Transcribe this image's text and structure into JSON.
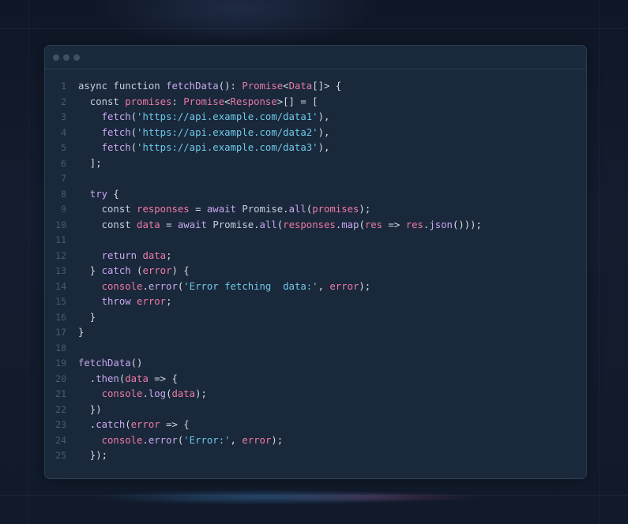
{
  "editor": {
    "lines": [
      {
        "n": "1",
        "tokens": [
          [
            "k",
            "async function "
          ],
          [
            "f",
            "fetchData"
          ],
          [
            "p",
            "(): "
          ],
          [
            "t",
            "Promise"
          ],
          [
            "p",
            "<"
          ],
          [
            "t",
            "Data"
          ],
          [
            "p",
            "[]> {"
          ]
        ]
      },
      {
        "n": "2",
        "tokens": [
          [
            "k",
            "  const "
          ],
          [
            "v",
            "promises"
          ],
          [
            "p",
            ": "
          ],
          [
            "t",
            "Promise"
          ],
          [
            "p",
            "<"
          ],
          [
            "t",
            "Response"
          ],
          [
            "p",
            ">[] = ["
          ]
        ]
      },
      {
        "n": "3",
        "tokens": [
          [
            "f",
            "    fetch"
          ],
          [
            "p",
            "("
          ],
          [
            "s",
            "'https://api.example.com/data1'"
          ],
          [
            "p",
            "),"
          ]
        ]
      },
      {
        "n": "4",
        "tokens": [
          [
            "f",
            "    fetch"
          ],
          [
            "p",
            "("
          ],
          [
            "s",
            "'https://api.example.com/data2'"
          ],
          [
            "p",
            "),"
          ]
        ]
      },
      {
        "n": "5",
        "tokens": [
          [
            "f",
            "    fetch"
          ],
          [
            "p",
            "("
          ],
          [
            "s",
            "'https://api.example.com/data3'"
          ],
          [
            "p",
            "),"
          ]
        ]
      },
      {
        "n": "6",
        "tokens": [
          [
            "p",
            "  ];"
          ]
        ]
      },
      {
        "n": "7",
        "tokens": []
      },
      {
        "n": "8",
        "tokens": [
          [
            "f",
            "  try"
          ],
          [
            "p",
            " {"
          ]
        ]
      },
      {
        "n": "9",
        "tokens": [
          [
            "k",
            "    const "
          ],
          [
            "v",
            "responses"
          ],
          [
            "p",
            " = "
          ],
          [
            "f",
            "await "
          ],
          [
            "k",
            "Promise"
          ],
          [
            "p",
            "."
          ],
          [
            "f",
            "all"
          ],
          [
            "p",
            "("
          ],
          [
            "v",
            "promises"
          ],
          [
            "p",
            ");"
          ]
        ]
      },
      {
        "n": "10",
        "tokens": [
          [
            "k",
            "    const "
          ],
          [
            "v",
            "data"
          ],
          [
            "p",
            " = "
          ],
          [
            "f",
            "await "
          ],
          [
            "k",
            "Promise"
          ],
          [
            "p",
            "."
          ],
          [
            "f",
            "all"
          ],
          [
            "p",
            "("
          ],
          [
            "v",
            "responses"
          ],
          [
            "p",
            "."
          ],
          [
            "f",
            "map"
          ],
          [
            "p",
            "("
          ],
          [
            "v",
            "res"
          ],
          [
            "p",
            " => "
          ],
          [
            "v",
            "res"
          ],
          [
            "p",
            "."
          ],
          [
            "f",
            "json"
          ],
          [
            "p",
            "()));"
          ]
        ]
      },
      {
        "n": "11",
        "tokens": []
      },
      {
        "n": "12",
        "tokens": [
          [
            "f",
            "    return "
          ],
          [
            "v",
            "data"
          ],
          [
            "p",
            ";"
          ]
        ]
      },
      {
        "n": "13",
        "tokens": [
          [
            "p",
            "  } "
          ],
          [
            "f",
            "catch"
          ],
          [
            "p",
            " ("
          ],
          [
            "v",
            "error"
          ],
          [
            "p",
            ") {"
          ]
        ]
      },
      {
        "n": "14",
        "tokens": [
          [
            "v",
            "    console"
          ],
          [
            "p",
            "."
          ],
          [
            "f",
            "error"
          ],
          [
            "p",
            "("
          ],
          [
            "s",
            "'Error fetching  data:'"
          ],
          [
            "p",
            ", "
          ],
          [
            "v",
            "error"
          ],
          [
            "p",
            ");"
          ]
        ]
      },
      {
        "n": "15",
        "tokens": [
          [
            "f",
            "    throw "
          ],
          [
            "v",
            "error"
          ],
          [
            "p",
            ";"
          ]
        ]
      },
      {
        "n": "16",
        "tokens": [
          [
            "p",
            "  }"
          ]
        ]
      },
      {
        "n": "17",
        "tokens": [
          [
            "p",
            "}"
          ]
        ]
      },
      {
        "n": "18",
        "tokens": []
      },
      {
        "n": "19",
        "tokens": [
          [
            "f",
            "fetchData"
          ],
          [
            "p",
            "()"
          ]
        ]
      },
      {
        "n": "20",
        "tokens": [
          [
            "p",
            "  ."
          ],
          [
            "f",
            "then"
          ],
          [
            "p",
            "("
          ],
          [
            "v",
            "data"
          ],
          [
            "p",
            " => {"
          ]
        ]
      },
      {
        "n": "21",
        "tokens": [
          [
            "v",
            "    console"
          ],
          [
            "p",
            "."
          ],
          [
            "f",
            "log"
          ],
          [
            "p",
            "("
          ],
          [
            "v",
            "data"
          ],
          [
            "p",
            ");"
          ]
        ]
      },
      {
        "n": "22",
        "tokens": [
          [
            "p",
            "  })"
          ]
        ]
      },
      {
        "n": "23",
        "tokens": [
          [
            "p",
            "  ."
          ],
          [
            "f",
            "catch"
          ],
          [
            "p",
            "("
          ],
          [
            "v",
            "error"
          ],
          [
            "p",
            " => {"
          ]
        ]
      },
      {
        "n": "24",
        "tokens": [
          [
            "v",
            "    console"
          ],
          [
            "p",
            "."
          ],
          [
            "f",
            "error"
          ],
          [
            "p",
            "("
          ],
          [
            "s",
            "'Error:'"
          ],
          [
            "p",
            ", "
          ],
          [
            "v",
            "error"
          ],
          [
            "p",
            ");"
          ]
        ]
      },
      {
        "n": "25",
        "tokens": [
          [
            "p",
            "  });"
          ]
        ]
      }
    ]
  }
}
